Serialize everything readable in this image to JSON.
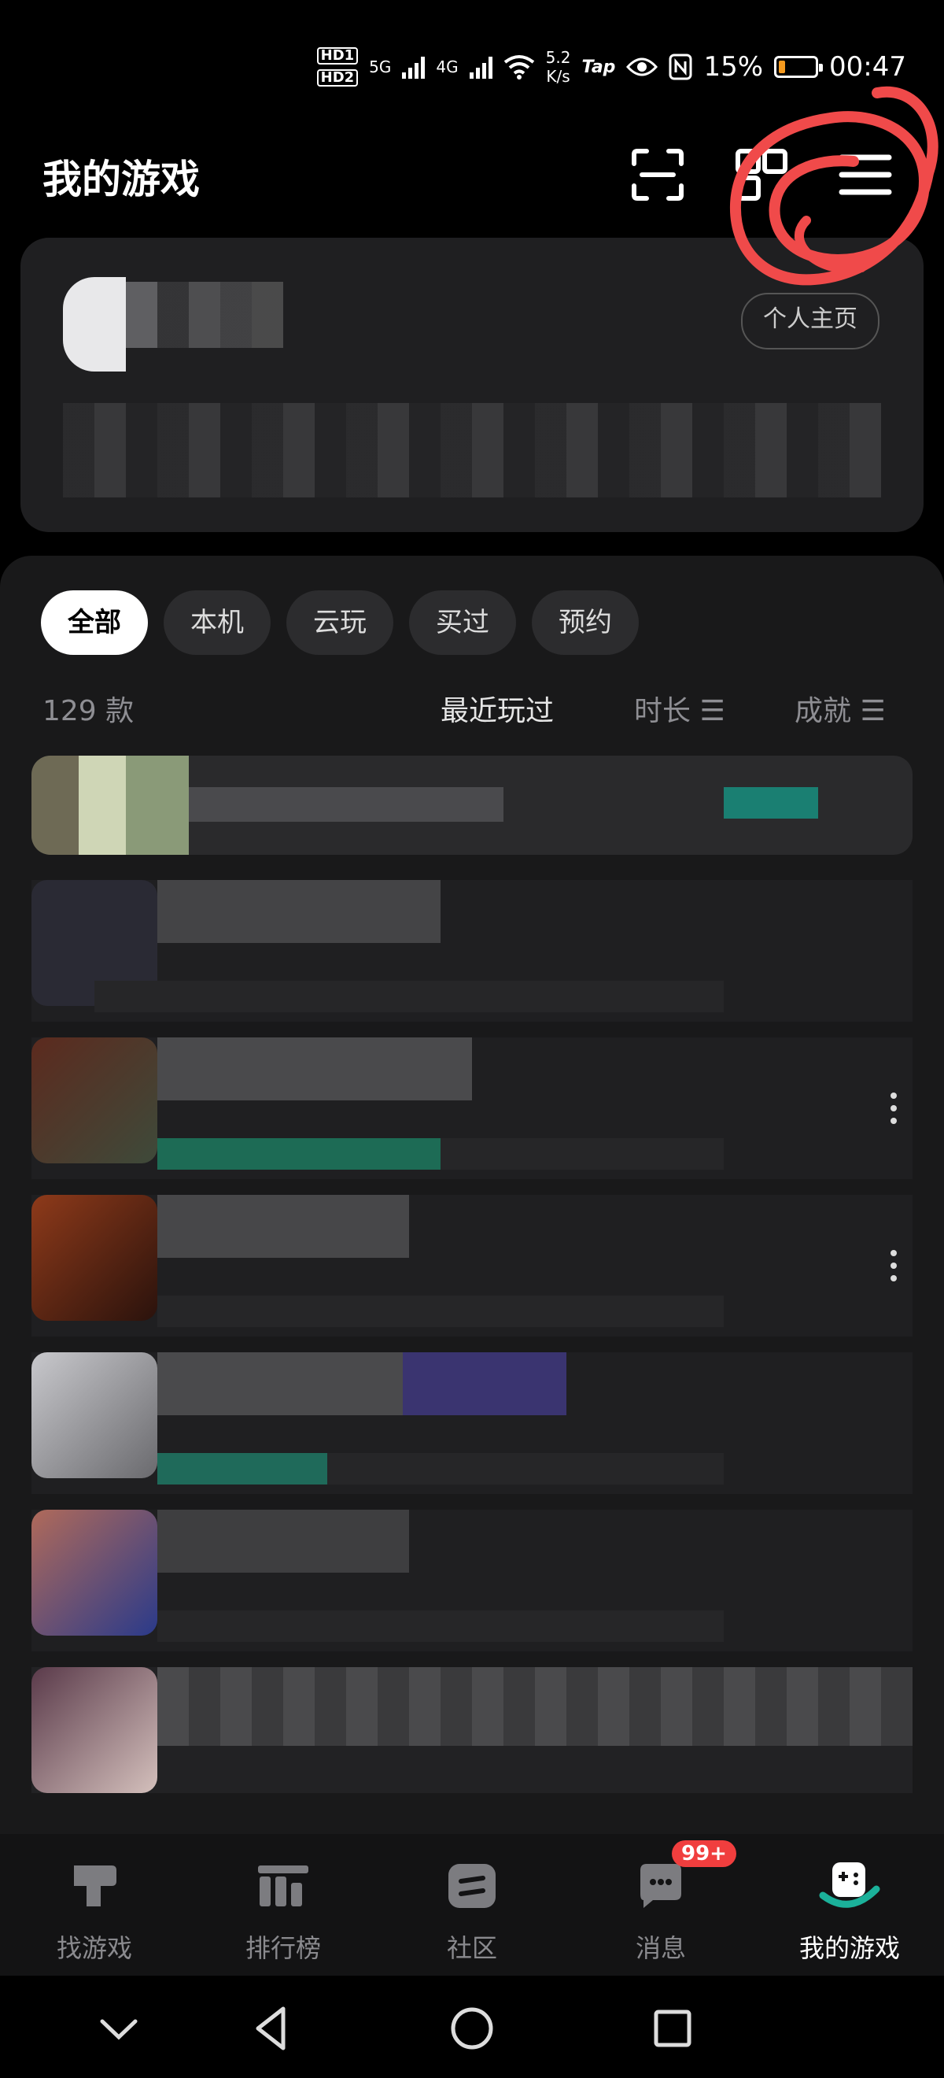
{
  "status_bar": {
    "hd_labels": [
      "HD1",
      "HD2"
    ],
    "net_types": [
      "5G",
      "4G"
    ],
    "speed": "5.2",
    "speed_unit": "K/s",
    "tap_label": "Tap",
    "battery": "15%",
    "time": "00:47"
  },
  "header": {
    "title": "我的游戏"
  },
  "profile": {
    "homepage_label": "个人主页"
  },
  "filters": {
    "tabs": [
      "全部",
      "本机",
      "云玩",
      "买过",
      "预约"
    ]
  },
  "list_meta": {
    "count": "129 款",
    "sort_recent": "最近玩过",
    "sort_time": "时长 ☰",
    "sort_achievement": "成就 ☰"
  },
  "bottom_nav": {
    "items": [
      "找游戏",
      "排行榜",
      "社区",
      "消息",
      "我的游戏"
    ],
    "badge": "99+"
  },
  "colors": {
    "accent": "#1bb19a",
    "annotation": "#f04a4a",
    "badge": "#f03e3e"
  }
}
